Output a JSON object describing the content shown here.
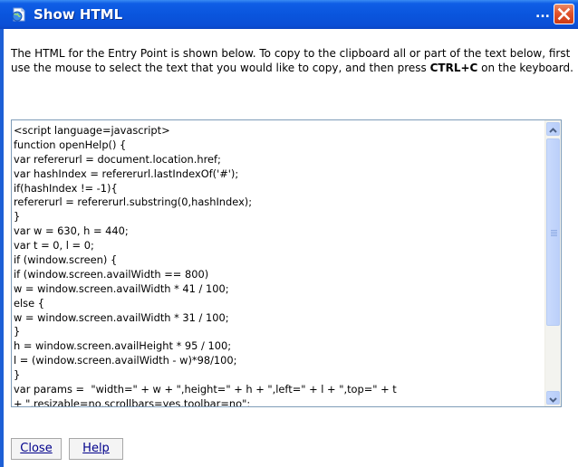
{
  "window": {
    "title": "Show HTML",
    "overflow_indicator": "...",
    "titlebar_color": "#0a55dd",
    "close_button_color": "#e0532c",
    "icons": {
      "app": "html-page-icon",
      "close": "close-icon"
    }
  },
  "description": {
    "part1": "The HTML for the Entry Point is shown below. To copy to the clipboard all or part of the text below, first use the mouse to select the text that you would like to copy, and then press ",
    "key": "CTRL+C",
    "part2": " on the keyboard."
  },
  "code": {
    "lines": [
      "<script language=javascript>",
      "function openHelp() {",
      "var refererurl = document.location.href;",
      "var hashIndex = refererurl.lastIndexOf('#');",
      "if(hashIndex != -1){",
      "refererurl = refererurl.substring(0,hashIndex);",
      "}",
      "var w = 630, h = 440;",
      "var t = 0, l = 0;",
      "if (window.screen) {",
      "if (window.screen.availWidth == 800)",
      "w = window.screen.availWidth * 41 / 100;",
      "else {",
      "w = window.screen.availWidth * 31 / 100;",
      "}",
      "h = window.screen.availHeight * 95 / 100;",
      "l = (window.screen.availWidth - w)*98/100;",
      "}",
      "var params =  \"width=\" + w + \",height=\" + h + \",left=\" + l + \",top=\" + t",
      "+ \",resizable=no,scrollbars=yes,toolbar=no\";"
    ]
  },
  "buttons": {
    "close": "Close",
    "help": "Help"
  }
}
